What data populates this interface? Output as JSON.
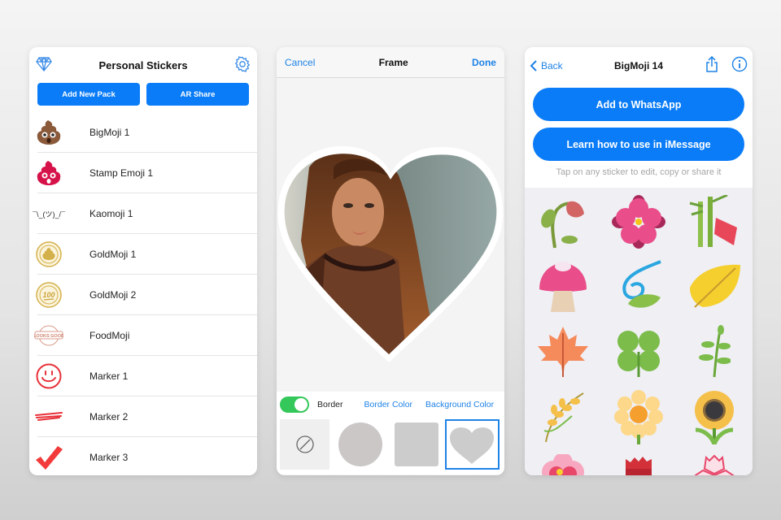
{
  "personal_stickers": {
    "title": "Personal Stickers",
    "buttons": {
      "add_new_pack": "Add New Pack",
      "ar_share": "AR Share"
    },
    "packs": [
      {
        "label": "BigMoji 1",
        "icon": "poop-emoji-icon"
      },
      {
        "label": "Stamp Emoji 1",
        "icon": "red-poop-stamp-icon"
      },
      {
        "label": "Kaomoji 1",
        "icon": "kaomoji-shrug-icon",
        "glyph": "¯\\_(ツ)_/¯"
      },
      {
        "label": "GoldMoji 1",
        "icon": "gold-coin-poop-icon"
      },
      {
        "label": "GoldMoji 2",
        "icon": "gold-coin-100-icon"
      },
      {
        "label": "FoodMoji",
        "icon": "looks-good-stamp-icon"
      },
      {
        "label": "Marker 1",
        "icon": "red-smiley-icon"
      },
      {
        "label": "Marker 2",
        "icon": "red-marker-stroke-icon"
      },
      {
        "label": "Marker 3",
        "icon": "red-checkmark-icon"
      }
    ]
  },
  "frame_editor": {
    "title": "Frame",
    "cancel": "Cancel",
    "done": "Done",
    "border_label": "Border",
    "border_enabled": true,
    "border_color": "Border Color",
    "background_color": "Background Color",
    "shapes": [
      "none",
      "circle",
      "square",
      "heart"
    ],
    "selected_shape": "heart"
  },
  "sticker_pack": {
    "back": "Back",
    "title": "BigMoji 14",
    "add_whatsapp": "Add to WhatsApp",
    "learn_imessage": "Learn how to use in iMessage",
    "hint": "Tap on any sticker to edit, copy or share it",
    "stickers": [
      "wilted-rose",
      "pink-flower",
      "bamboo-tanabata",
      "mushroom",
      "wind-leaf",
      "yellow-leaf",
      "maple-leaf",
      "four-leaf-clover",
      "herb",
      "rice-ear",
      "yellow-daisy",
      "sunflower",
      "plum-blossom",
      "red-rose",
      "cherry-blossom"
    ]
  },
  "colors": {
    "accent": "#0a7cf7",
    "link": "#1e82e6",
    "toggle_on": "#34c759"
  }
}
